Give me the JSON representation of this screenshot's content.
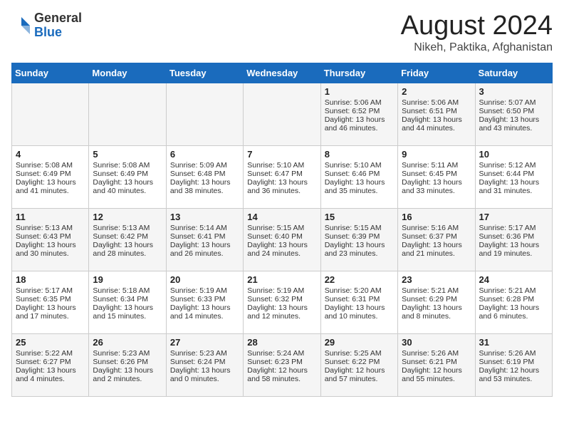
{
  "header": {
    "logo_general": "General",
    "logo_blue": "Blue",
    "month_year": "August 2024",
    "location": "Nikeh, Paktika, Afghanistan"
  },
  "weekdays": [
    "Sunday",
    "Monday",
    "Tuesday",
    "Wednesday",
    "Thursday",
    "Friday",
    "Saturday"
  ],
  "weeks": [
    [
      {
        "day": "",
        "content": ""
      },
      {
        "day": "",
        "content": ""
      },
      {
        "day": "",
        "content": ""
      },
      {
        "day": "",
        "content": ""
      },
      {
        "day": "1",
        "content": "Sunrise: 5:06 AM\nSunset: 6:52 PM\nDaylight: 13 hours\nand 46 minutes."
      },
      {
        "day": "2",
        "content": "Sunrise: 5:06 AM\nSunset: 6:51 PM\nDaylight: 13 hours\nand 44 minutes."
      },
      {
        "day": "3",
        "content": "Sunrise: 5:07 AM\nSunset: 6:50 PM\nDaylight: 13 hours\nand 43 minutes."
      }
    ],
    [
      {
        "day": "4",
        "content": "Sunrise: 5:08 AM\nSunset: 6:49 PM\nDaylight: 13 hours\nand 41 minutes."
      },
      {
        "day": "5",
        "content": "Sunrise: 5:08 AM\nSunset: 6:49 PM\nDaylight: 13 hours\nand 40 minutes."
      },
      {
        "day": "6",
        "content": "Sunrise: 5:09 AM\nSunset: 6:48 PM\nDaylight: 13 hours\nand 38 minutes."
      },
      {
        "day": "7",
        "content": "Sunrise: 5:10 AM\nSunset: 6:47 PM\nDaylight: 13 hours\nand 36 minutes."
      },
      {
        "day": "8",
        "content": "Sunrise: 5:10 AM\nSunset: 6:46 PM\nDaylight: 13 hours\nand 35 minutes."
      },
      {
        "day": "9",
        "content": "Sunrise: 5:11 AM\nSunset: 6:45 PM\nDaylight: 13 hours\nand 33 minutes."
      },
      {
        "day": "10",
        "content": "Sunrise: 5:12 AM\nSunset: 6:44 PM\nDaylight: 13 hours\nand 31 minutes."
      }
    ],
    [
      {
        "day": "11",
        "content": "Sunrise: 5:13 AM\nSunset: 6:43 PM\nDaylight: 13 hours\nand 30 minutes."
      },
      {
        "day": "12",
        "content": "Sunrise: 5:13 AM\nSunset: 6:42 PM\nDaylight: 13 hours\nand 28 minutes."
      },
      {
        "day": "13",
        "content": "Sunrise: 5:14 AM\nSunset: 6:41 PM\nDaylight: 13 hours\nand 26 minutes."
      },
      {
        "day": "14",
        "content": "Sunrise: 5:15 AM\nSunset: 6:40 PM\nDaylight: 13 hours\nand 24 minutes."
      },
      {
        "day": "15",
        "content": "Sunrise: 5:15 AM\nSunset: 6:39 PM\nDaylight: 13 hours\nand 23 minutes."
      },
      {
        "day": "16",
        "content": "Sunrise: 5:16 AM\nSunset: 6:37 PM\nDaylight: 13 hours\nand 21 minutes."
      },
      {
        "day": "17",
        "content": "Sunrise: 5:17 AM\nSunset: 6:36 PM\nDaylight: 13 hours\nand 19 minutes."
      }
    ],
    [
      {
        "day": "18",
        "content": "Sunrise: 5:17 AM\nSunset: 6:35 PM\nDaylight: 13 hours\nand 17 minutes."
      },
      {
        "day": "19",
        "content": "Sunrise: 5:18 AM\nSunset: 6:34 PM\nDaylight: 13 hours\nand 15 minutes."
      },
      {
        "day": "20",
        "content": "Sunrise: 5:19 AM\nSunset: 6:33 PM\nDaylight: 13 hours\nand 14 minutes."
      },
      {
        "day": "21",
        "content": "Sunrise: 5:19 AM\nSunset: 6:32 PM\nDaylight: 13 hours\nand 12 minutes."
      },
      {
        "day": "22",
        "content": "Sunrise: 5:20 AM\nSunset: 6:31 PM\nDaylight: 13 hours\nand 10 minutes."
      },
      {
        "day": "23",
        "content": "Sunrise: 5:21 AM\nSunset: 6:29 PM\nDaylight: 13 hours\nand 8 minutes."
      },
      {
        "day": "24",
        "content": "Sunrise: 5:21 AM\nSunset: 6:28 PM\nDaylight: 13 hours\nand 6 minutes."
      }
    ],
    [
      {
        "day": "25",
        "content": "Sunrise: 5:22 AM\nSunset: 6:27 PM\nDaylight: 13 hours\nand 4 minutes."
      },
      {
        "day": "26",
        "content": "Sunrise: 5:23 AM\nSunset: 6:26 PM\nDaylight: 13 hours\nand 2 minutes."
      },
      {
        "day": "27",
        "content": "Sunrise: 5:23 AM\nSunset: 6:24 PM\nDaylight: 13 hours\nand 0 minutes."
      },
      {
        "day": "28",
        "content": "Sunrise: 5:24 AM\nSunset: 6:23 PM\nDaylight: 12 hours\nand 58 minutes."
      },
      {
        "day": "29",
        "content": "Sunrise: 5:25 AM\nSunset: 6:22 PM\nDaylight: 12 hours\nand 57 minutes."
      },
      {
        "day": "30",
        "content": "Sunrise: 5:26 AM\nSunset: 6:21 PM\nDaylight: 12 hours\nand 55 minutes."
      },
      {
        "day": "31",
        "content": "Sunrise: 5:26 AM\nSunset: 6:19 PM\nDaylight: 12 hours\nand 53 minutes."
      }
    ]
  ]
}
